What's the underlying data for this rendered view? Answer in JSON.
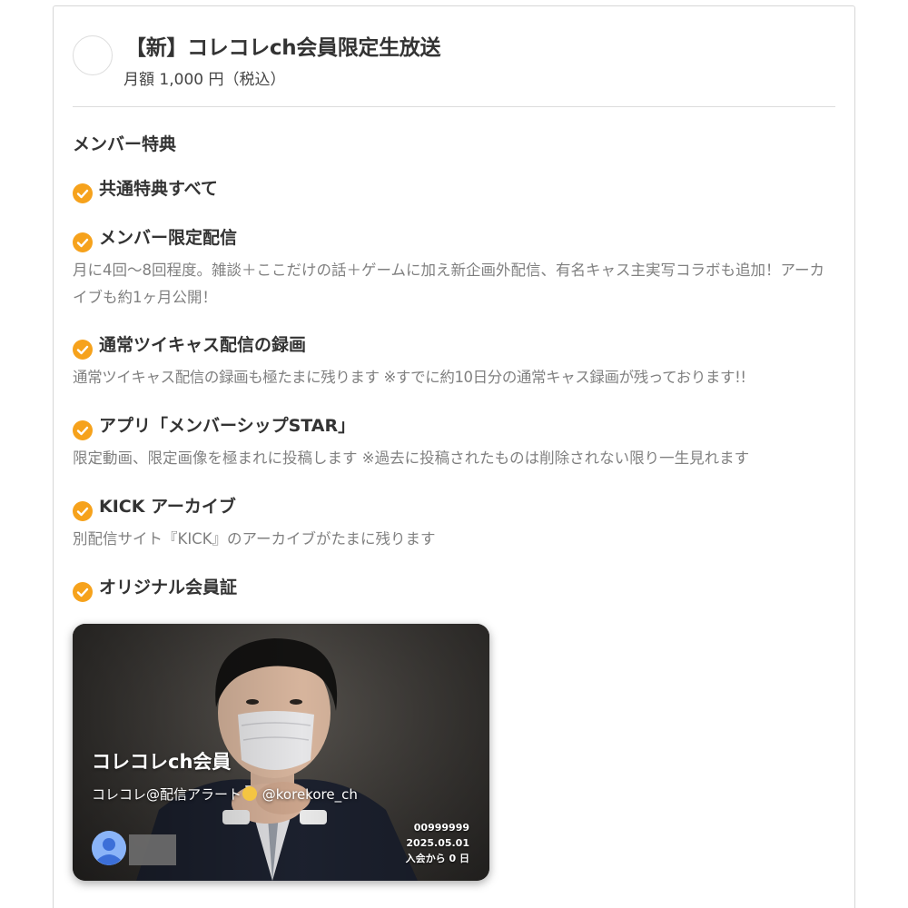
{
  "plan": {
    "title": "【新】コレコレch会員限定生放送",
    "price": "月額 1,000 円（税込）"
  },
  "benefits_heading": "メンバー特典",
  "benefits": [
    {
      "title": "共通特典すべて",
      "description": ""
    },
    {
      "title": "メンバー限定配信",
      "description": "月に4回〜8回程度。雑談＋ここだけの話＋ゲームに加え新企画外配信、有名キャス主実写コラボも追加！アーカイブも約1ヶ月公開！"
    },
    {
      "title": "通常ツイキャス配信の録画",
      "description": "通常ツイキャス配信の録画も極たまに残ります ※すでに約10日分の通常キャス録画が残っております!!"
    },
    {
      "title": "アプリ「メンバーシップSTAR」",
      "description": "限定動画、限定画像を極まれに投稿します ※過去に投稿されたものは削除されない限り一生見れます"
    },
    {
      "title": "KICK アーカイブ",
      "description": "別配信サイト『KICK』のアーカイブがたまに残ります"
    },
    {
      "title": "オリジナル会員証",
      "description": ""
    }
  ],
  "member_card": {
    "title": "コレコレch会員",
    "subtitle_prefix": "コレコレ@配信アラート",
    "subtitle_suffix": " @korekore_ch",
    "member_number": "00999999",
    "date": "2025.05.01",
    "joined": "入会から 0 日"
  },
  "colors": {
    "accent": "#f6a21c",
    "text": "#333333",
    "muted": "#808080",
    "border": "#d7d7d7"
  },
  "icons": {
    "benefit": "check-circle-icon",
    "avatar": "user-avatar-icon"
  }
}
